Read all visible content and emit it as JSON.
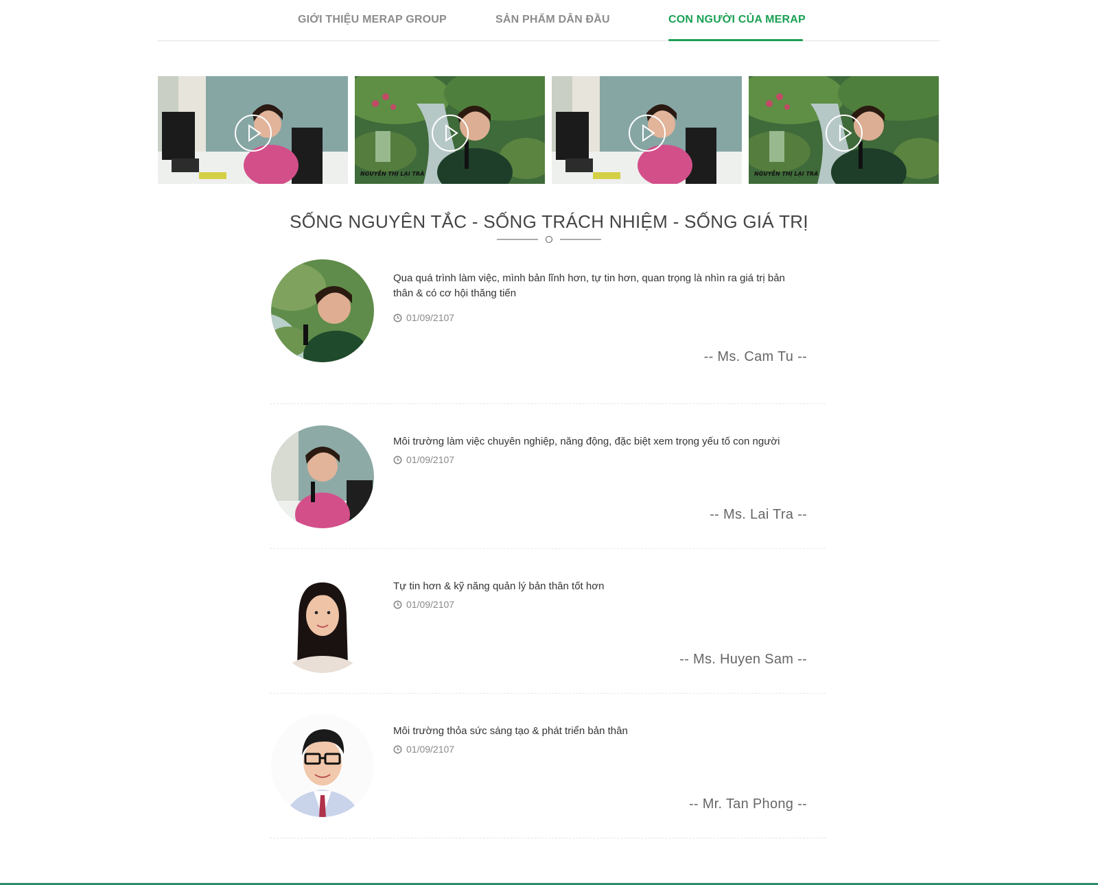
{
  "tabs": [
    {
      "label": "GIỚI THIỆU MERAP GROUP",
      "active": false
    },
    {
      "label": "SẢN PHẨM DẪN ĐẦU",
      "active": false
    },
    {
      "label": "CON NGƯỜI CỦA MERAP",
      "active": true
    }
  ],
  "colors": {
    "accent": "#1aa053",
    "text": "#333333",
    "muted": "#888888"
  },
  "videos": [
    {
      "scene": "office",
      "caption": "",
      "icon": "play-icon"
    },
    {
      "scene": "waterfall",
      "caption": "NGUYỄN THỊ LẠI TRÀ",
      "icon": "play-icon"
    },
    {
      "scene": "office",
      "caption": "",
      "icon": "play-icon"
    },
    {
      "scene": "waterfall",
      "caption": "NGUYỄN THỊ LẠI TRÀ",
      "icon": "play-icon"
    }
  ],
  "section": {
    "title": "SỐNG NGUYÊN TẮC - SỐNG TRÁCH NHIỆM - SỐNG GIÁ TRỊ"
  },
  "testimonials": [
    {
      "quote": "Qua quá trình làm việc, mình bản lĩnh hơn, tự tin hơn, quan trọng là nhìn ra giá trị bản thân & có cơ hội thăng tiến",
      "date": "01/09/2107",
      "author": "-- Ms. Cam Tu --"
    },
    {
      "quote": "Môi trường làm việc chuyên nghiệp, năng động, đặc biệt xem trọng yếu tố con người",
      "date": "01/09/2107",
      "author": "-- Ms. Lai Tra --"
    },
    {
      "quote": "Tự tin hơn & kỹ năng quản lý bản thân tốt hơn",
      "date": "01/09/2107",
      "author": "-- Ms. Huyen Sam --"
    },
    {
      "quote": "Môi trường thỏa sức sáng tạo & phát triển bản thân",
      "date": "01/09/2107",
      "author": "-- Mr. Tan Phong --"
    }
  ]
}
